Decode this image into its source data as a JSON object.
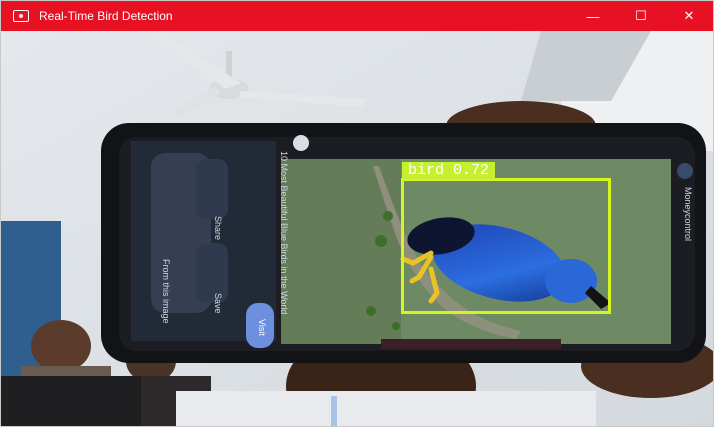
{
  "window": {
    "title": "Real-Time Bird Detection",
    "controls": {
      "minimize": "—",
      "maximize": "☐",
      "close": "✕"
    }
  },
  "phone_screen": {
    "article_title": "10 Most Beautiful Blue Birds in the World",
    "share_label": "Share",
    "save_label": "Save",
    "from_image_label": "From this image",
    "visit_label": "Visit",
    "side_label": "Moneycontrol"
  },
  "detection": {
    "label": "bird",
    "confidence": "0.72",
    "box_color": "#d5f51e",
    "label_bg": "#c6ef2e"
  }
}
